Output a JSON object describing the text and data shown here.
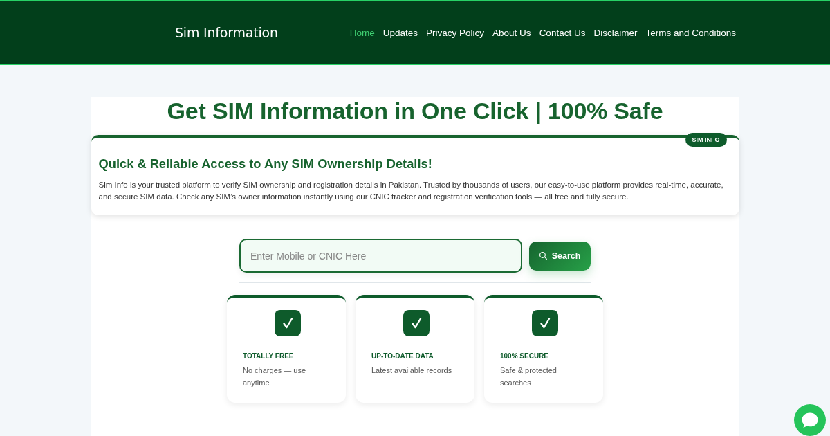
{
  "header": {
    "logo": "Sim Information",
    "nav": [
      {
        "label": "Home",
        "selected": true
      },
      {
        "label": "Updates",
        "selected": false
      },
      {
        "label": "Privacy Policy",
        "selected": false
      },
      {
        "label": "About Us",
        "selected": false
      },
      {
        "label": "Contact Us",
        "selected": false
      },
      {
        "label": "Disclaimer",
        "selected": false
      },
      {
        "label": "Terms and Conditions",
        "selected": false
      }
    ]
  },
  "hero": {
    "title": "Get SIM Information in One Click | 100% Safe"
  },
  "intro_card": {
    "badge": "SIM INFO",
    "heading": "Quick & Reliable Access to Any SIM Ownership Details!",
    "text": "Sim Info is your trusted platform to verify SIM ownership and registration details in Pakistan. Trusted by thousands of users, our easy-to-use platform provides real-time, accurate, and secure SIM data. Check any SIM’s owner information instantly using our CNIC tracker and registration verification tools — all free and fully secure."
  },
  "search": {
    "placeholder": "Enter Mobile or CNIC Here",
    "button": "Search"
  },
  "features": [
    {
      "title": "TOTALLY FREE",
      "text": "No charges — use anytime"
    },
    {
      "title": "UP-TO-DATE DATA",
      "text": "Latest available records"
    },
    {
      "title": "100% SECURE",
      "text": "Safe & protected searches"
    }
  ]
}
